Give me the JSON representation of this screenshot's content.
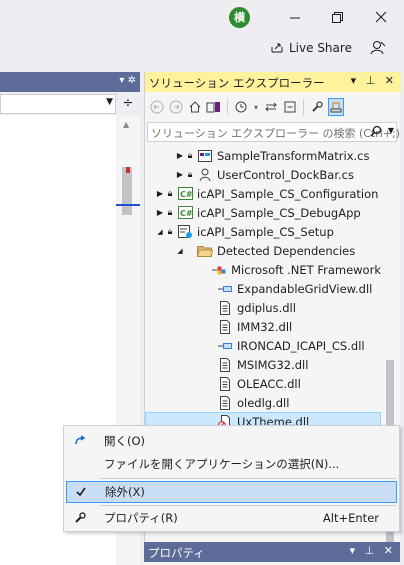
{
  "titlebar": {
    "avatar": "横",
    "minimize_icon": "minimize-icon",
    "restore_icon": "restore-icon",
    "close_icon": "close-icon"
  },
  "toolbar": {
    "live_share": "Live Share"
  },
  "solution_explorer": {
    "title": "ソリューション エクスプローラー",
    "search_placeholder": "ソリューション エクスプローラー の検索 (Ctrl+;)",
    "tree": [
      {
        "label": "SampleTransformMatrix.cs",
        "icon": "cs-form-icon"
      },
      {
        "label": "UserControl_DockBar.cs",
        "icon": "user-control-icon"
      },
      {
        "label": "icAPI_Sample_CS_Configuration",
        "icon": "csharp-project-icon"
      },
      {
        "label": "icAPI_Sample_CS_DebugApp",
        "icon": "csharp-project-icon"
      },
      {
        "label": "icAPI_Sample_CS_Setup",
        "icon": "setup-project-icon"
      },
      {
        "label": "Detected Dependencies",
        "icon": "folder-icon"
      },
      {
        "label": "Microsoft .NET Framework",
        "icon": "merge-module-icon"
      },
      {
        "label": "ExpandableGridView.dll",
        "icon": "assembly-icon"
      },
      {
        "label": "gdiplus.dll",
        "icon": "file-icon"
      },
      {
        "label": "IMM32.dll",
        "icon": "file-icon"
      },
      {
        "label": "IRONCAD_ICAPI_CS.dll",
        "icon": "assembly-icon"
      },
      {
        "label": "MSIMG32.dll",
        "icon": "file-icon"
      },
      {
        "label": "OLEACC.dll",
        "icon": "file-icon"
      },
      {
        "label": "oledlg.dll",
        "icon": "file-icon"
      },
      {
        "label": "UxTheme.dll",
        "icon": "excluded-file-icon"
      }
    ]
  },
  "context_menu": {
    "items": [
      {
        "label": "開く(O)",
        "shortcut": ""
      },
      {
        "label": "ファイルを開くアプリケーションの選択(N)...",
        "shortcut": ""
      },
      {
        "label": "除外(X)",
        "shortcut": ""
      },
      {
        "label": "プロパティ(R)",
        "shortcut": "Alt+Enter"
      }
    ]
  },
  "properties": {
    "title": "プロパティ"
  },
  "colors": {
    "accent_yellow": "#fff29d",
    "panel_header_blue": "#5d6b99",
    "menu_highlight": "#c9def5",
    "selection": "#cce8ff"
  }
}
